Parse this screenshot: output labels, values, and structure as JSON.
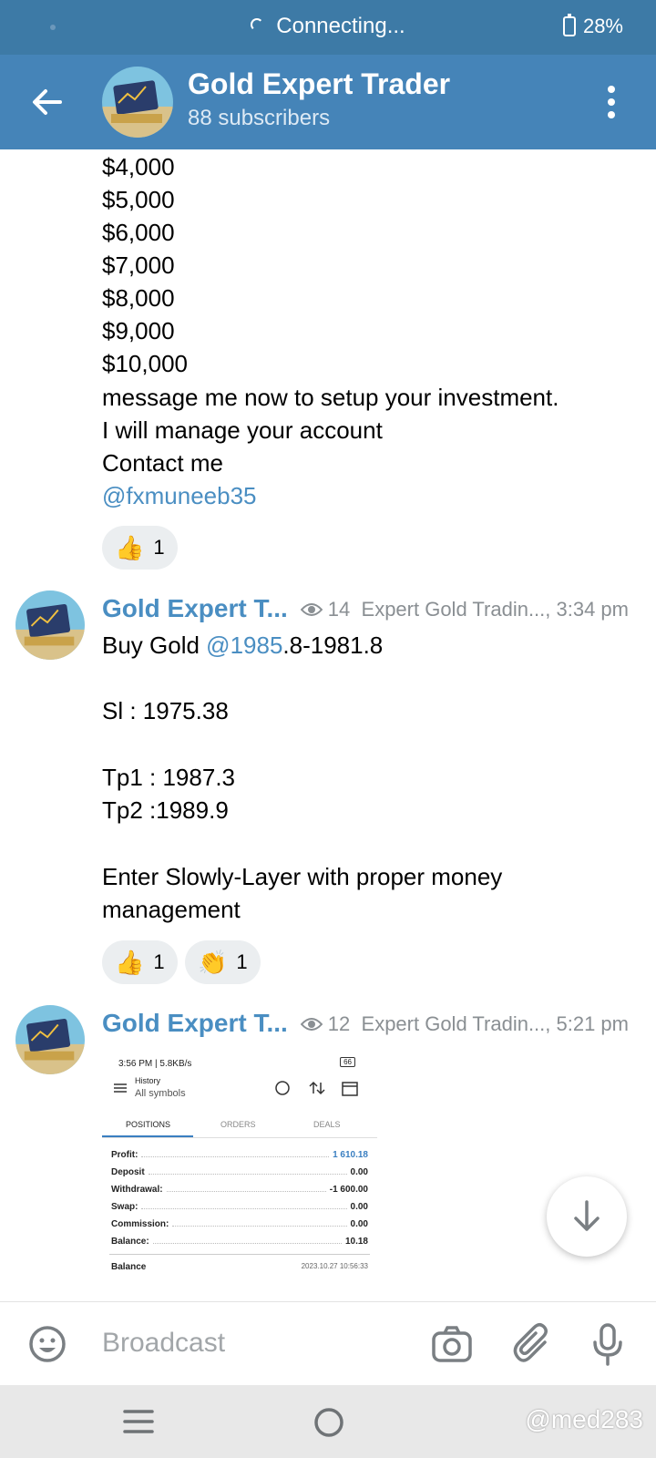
{
  "status_bar": {
    "connection_text": "Connecting...",
    "battery": "28%"
  },
  "header": {
    "channel_name": "Gold Expert Trader",
    "subscribers": "88 subscribers"
  },
  "messages": [
    {
      "lines": [
        "$4,000",
        "$5,000",
        "$6,000",
        "$7,000",
        "$8,000",
        "$9,000",
        "$10,000",
        "message me now to setup your investment.",
        "I will manage your account",
        "Contact me"
      ],
      "link": "@fxmuneeb35",
      "reactions": [
        {
          "emoji": "👍",
          "count": "1"
        }
      ]
    },
    {
      "sender": "Gold Expert T...",
      "views": "14",
      "signature": "Expert Gold Tradin..., 3:34 pm",
      "buy_prefix": "Buy Gold ",
      "buy_link": "@1985",
      "buy_suffix": ".8-1981.8",
      "sl": "Sl : 1975.38",
      "tp1": "Tp1 : 1987.3",
      "tp2": "Tp2 :1989.9",
      "note_line1": "Enter Slowly-Layer with proper money",
      "note_line2": "management",
      "reactions": [
        {
          "emoji": "👍",
          "count": "1"
        },
        {
          "emoji": "👏",
          "count": "1"
        }
      ]
    },
    {
      "sender": "Gold Expert T...",
      "views": "12",
      "signature": "Expert Gold Tradin..., 5:21 pm",
      "screenshot": {
        "status_left": "3:56 PM | 5.8KB/s",
        "status_battery": "66",
        "title": "History",
        "subtitle": "All symbols",
        "tabs": [
          "POSITIONS",
          "ORDERS",
          "DEALS"
        ],
        "rows": [
          {
            "label": "Profit:",
            "value": "1 610.18"
          },
          {
            "label": "Deposit",
            "value": "0.00"
          },
          {
            "label": "Withdrawal:",
            "value": "-1 600.00"
          },
          {
            "label": "Swap:",
            "value": "0.00"
          },
          {
            "label": "Commission:",
            "value": "0.00"
          },
          {
            "label": "Balance:",
            "value": "10.18"
          }
        ],
        "footer_label": "Balance",
        "footer_date": "2023.10.27 10:56:33"
      }
    }
  ],
  "input": {
    "placeholder": "Broadcast"
  },
  "watermark": "@med283",
  "colors": {
    "header_bg": "#4584b8",
    "status_bg": "#3d7aa6",
    "link": "#4a8ec2"
  }
}
